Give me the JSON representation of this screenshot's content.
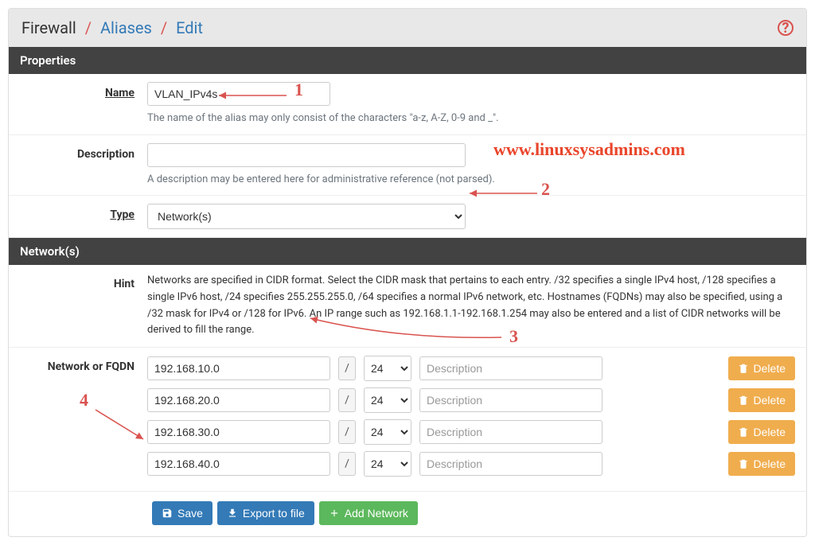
{
  "breadcrumb": {
    "root": "Firewall",
    "mid": "Aliases",
    "leaf": "Edit"
  },
  "sections": {
    "properties": "Properties",
    "networks": "Network(s)"
  },
  "labels": {
    "name": "Name",
    "description": "Description",
    "type": "Type",
    "hint": "Hint",
    "netfqdn": "Network or FQDN"
  },
  "fields": {
    "name": "VLAN_IPv4s",
    "name_help": "The name of the alias may only consist of the characters \"a-z, A-Z, 0-9 and _\".",
    "description": "",
    "description_help": "A description may be entered here for administrative reference (not parsed).",
    "type": "Network(s)"
  },
  "hint_text": "Networks are specified in CIDR format. Select the CIDR mask that pertains to each entry. /32 specifies a single IPv4 host, /128 specifies a single IPv6 host, /24 specifies 255.255.255.0, /64 specifies a normal IPv6 network, etc. Hostnames (FQDNs) may also be specified, using a /32 mask for IPv4 or /128 for IPv6. An IP range such as 192.168.1.1-192.168.1.254 may also be entered and a list of CIDR networks will be derived to fill the range.",
  "net_rows": [
    {
      "addr": "192.168.10.0",
      "cidr": "24",
      "desc_ph": "Description"
    },
    {
      "addr": "192.168.20.0",
      "cidr": "24",
      "desc_ph": "Description"
    },
    {
      "addr": "192.168.30.0",
      "cidr": "24",
      "desc_ph": "Description"
    },
    {
      "addr": "192.168.40.0",
      "cidr": "24",
      "desc_ph": "Description"
    }
  ],
  "slash": "/",
  "buttons": {
    "delete": "Delete",
    "save": "Save",
    "export": "Export to file",
    "add": "Add Network"
  },
  "watermark": "www.linuxsysadmins.com",
  "ann": {
    "a1": "1",
    "a2": "2",
    "a3": "3",
    "a4": "4"
  }
}
